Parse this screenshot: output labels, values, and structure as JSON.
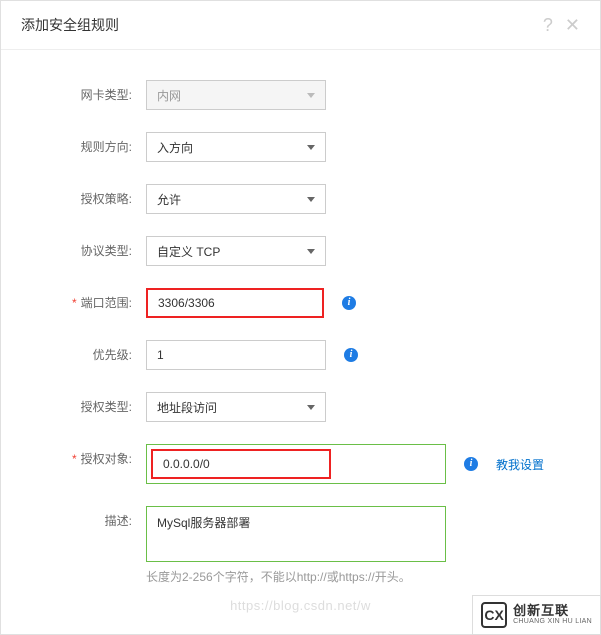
{
  "modal": {
    "title": "添加安全组规则",
    "help_icon": "?",
    "close_icon": "✕"
  },
  "form": {
    "nic_type": {
      "label": "网卡类型:",
      "value": "内网"
    },
    "direction": {
      "label": "规则方向:",
      "value": "入方向"
    },
    "auth_policy": {
      "label": "授权策略:",
      "value": "允许"
    },
    "protocol": {
      "label": "协议类型:",
      "value": "自定义 TCP"
    },
    "port_range": {
      "label": "端口范围:",
      "value": "3306/3306"
    },
    "priority": {
      "label": "优先级:",
      "value": "1"
    },
    "auth_type": {
      "label": "授权类型:",
      "value": "地址段访问"
    },
    "auth_object": {
      "label": "授权对象:",
      "value": "0.0.0.0/0",
      "link": "教我设置"
    },
    "description": {
      "label": "描述:",
      "value": "MySql服务器部署",
      "hint": "长度为2-256个字符，不能以http://或https://开头。"
    }
  },
  "watermark": "https://blog.csdn.net/w",
  "brand": {
    "logo": "CX",
    "cn": "创新互联",
    "en": "CHUANG XIN HU LIAN"
  },
  "icons": {
    "info": "i"
  }
}
